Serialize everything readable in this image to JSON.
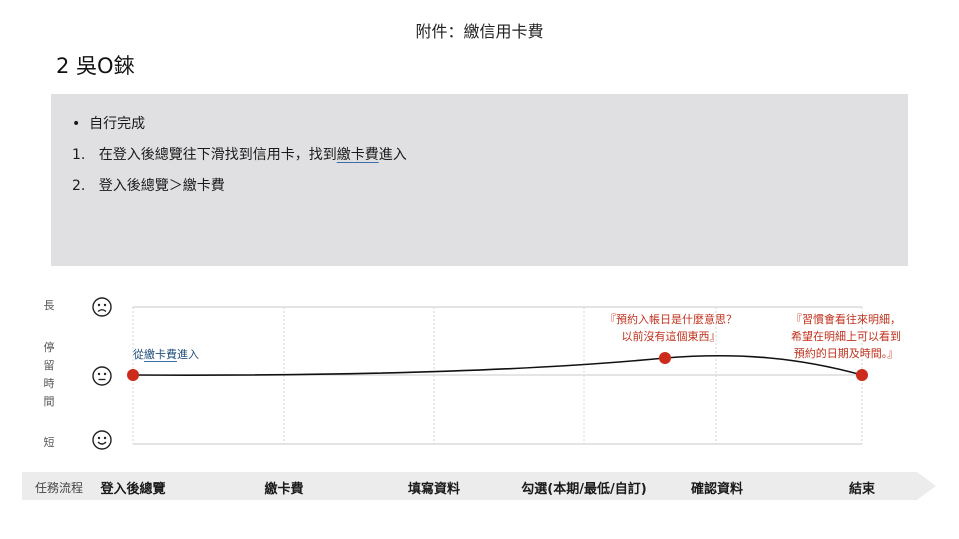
{
  "header": {
    "title": "附件：繳信用卡費"
  },
  "user": {
    "title": "2 吳O錸"
  },
  "notes": {
    "items": [
      {
        "prefix": "•",
        "text": "自行完成"
      },
      {
        "prefix": "1.",
        "text_before": "在登入後總覽往下滑找到信用卡，找到",
        "text_underlined": "繳卡費",
        "text_after": "進入"
      },
      {
        "prefix": "2.",
        "text": "登入後總覽＞繳卡費"
      }
    ]
  },
  "y_axis": {
    "top_label": "長",
    "middle_label": [
      "停",
      "留",
      "時",
      "間"
    ],
    "bottom_label": "短",
    "faces": [
      "sad-face-icon",
      "neutral-face-icon",
      "happy-face-icon"
    ]
  },
  "chart_data": {
    "type": "line",
    "x_categories": [
      "登入後總覽",
      "繳卡費",
      "填寫資料",
      "勾選(本期/最低/自訂)",
      "確認資料",
      "結束"
    ],
    "y_scale": [
      "短",
      "中",
      "長"
    ],
    "points": [
      {
        "x": "登入後總覽",
        "level": "中",
        "annotation": "從繳卡費進入",
        "annotation_underlined": "繳卡費"
      },
      {
        "x": "勾選(本期/最低/自訂)~確認資料",
        "level": "中+",
        "annotation_lines": [
          "『預約入帳日是什麼意思？",
          "以前沒有這個東西』"
        ]
      },
      {
        "x": "結束",
        "level": "中",
        "annotation_lines": [
          "『習慣會看往來明細，",
          "希望在明細上可以看到",
          "預約的日期及時間。』"
        ]
      }
    ]
  },
  "flow": {
    "label": "任務流程",
    "steps": [
      "登入後總覽",
      "繳卡費",
      "填寫資料",
      "勾選(本期/最低/自訂)",
      "確認資料",
      "結束"
    ]
  },
  "colors": {
    "notes_bg": "#e0e0e2",
    "point": "#cc2a1a",
    "annotation": "#c0321e",
    "start_annotation": "#1f4e79",
    "flow_bar": "#ececec"
  }
}
